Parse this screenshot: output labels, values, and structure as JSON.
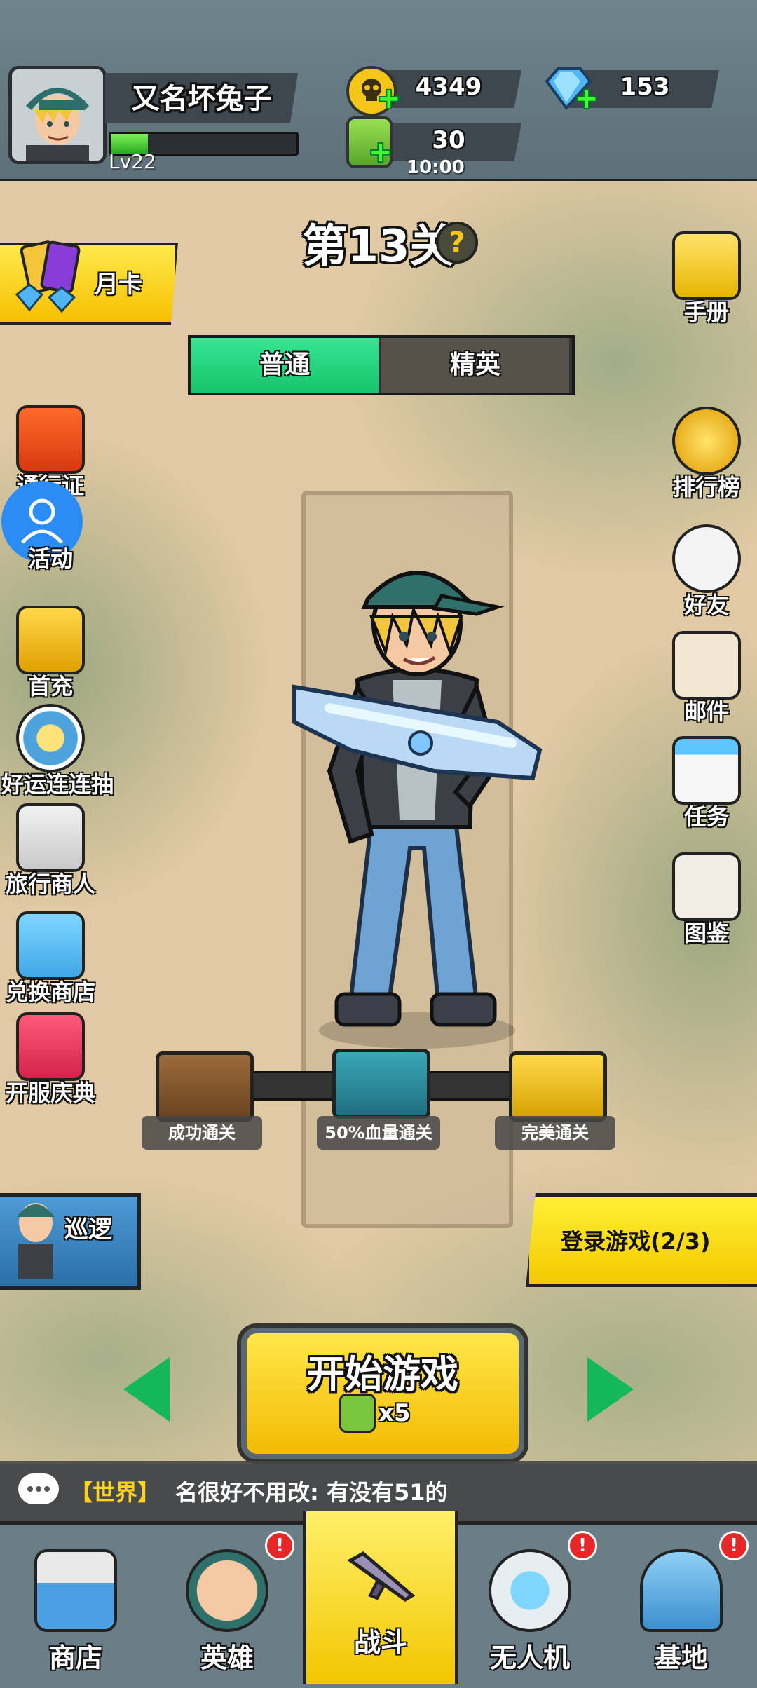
{
  "player": {
    "name": "又名坏兔子",
    "level": "Lv22",
    "xp_fraction": 0.2
  },
  "currency": {
    "gold": "4349",
    "gems": "153",
    "energy": "30",
    "energy_timer": "10:00"
  },
  "stage": {
    "title": "第13关",
    "help": "?"
  },
  "difficulty": {
    "tabs": [
      "普通",
      "精英"
    ],
    "selected": "普通"
  },
  "month_card": "月卡",
  "left_menu": {
    "pass": "通行证",
    "activity": "活动",
    "first_charge": "首充",
    "lucky_draw": "好运连连抽",
    "traveling_merchant": "旅行商人",
    "exchange_shop": "兑换商店",
    "opening_celebration": "开服庆典"
  },
  "right_menu": {
    "handbook": "手册",
    "leaderboard": "排行榜",
    "friends": "好友",
    "mail": "邮件",
    "tasks": "任务",
    "collection": "图鉴"
  },
  "rewards": [
    "成功通关",
    "50%血量通关",
    "完美通关"
  ],
  "patrol": "巡逻",
  "login_banner": "登录游戏(2/3)",
  "start": {
    "label": "开始游戏",
    "cost": "x5"
  },
  "chat": {
    "channel": "【世界】",
    "message": "名很好不用改: 有没有51的"
  },
  "nav": {
    "items": [
      "商店",
      "英雄",
      "战斗",
      "无人机",
      "基地"
    ],
    "active": "战斗"
  },
  "colors": {
    "accent_yellow": "#f6c800",
    "accent_green": "#1fcf78",
    "badge_red": "#e72626"
  }
}
